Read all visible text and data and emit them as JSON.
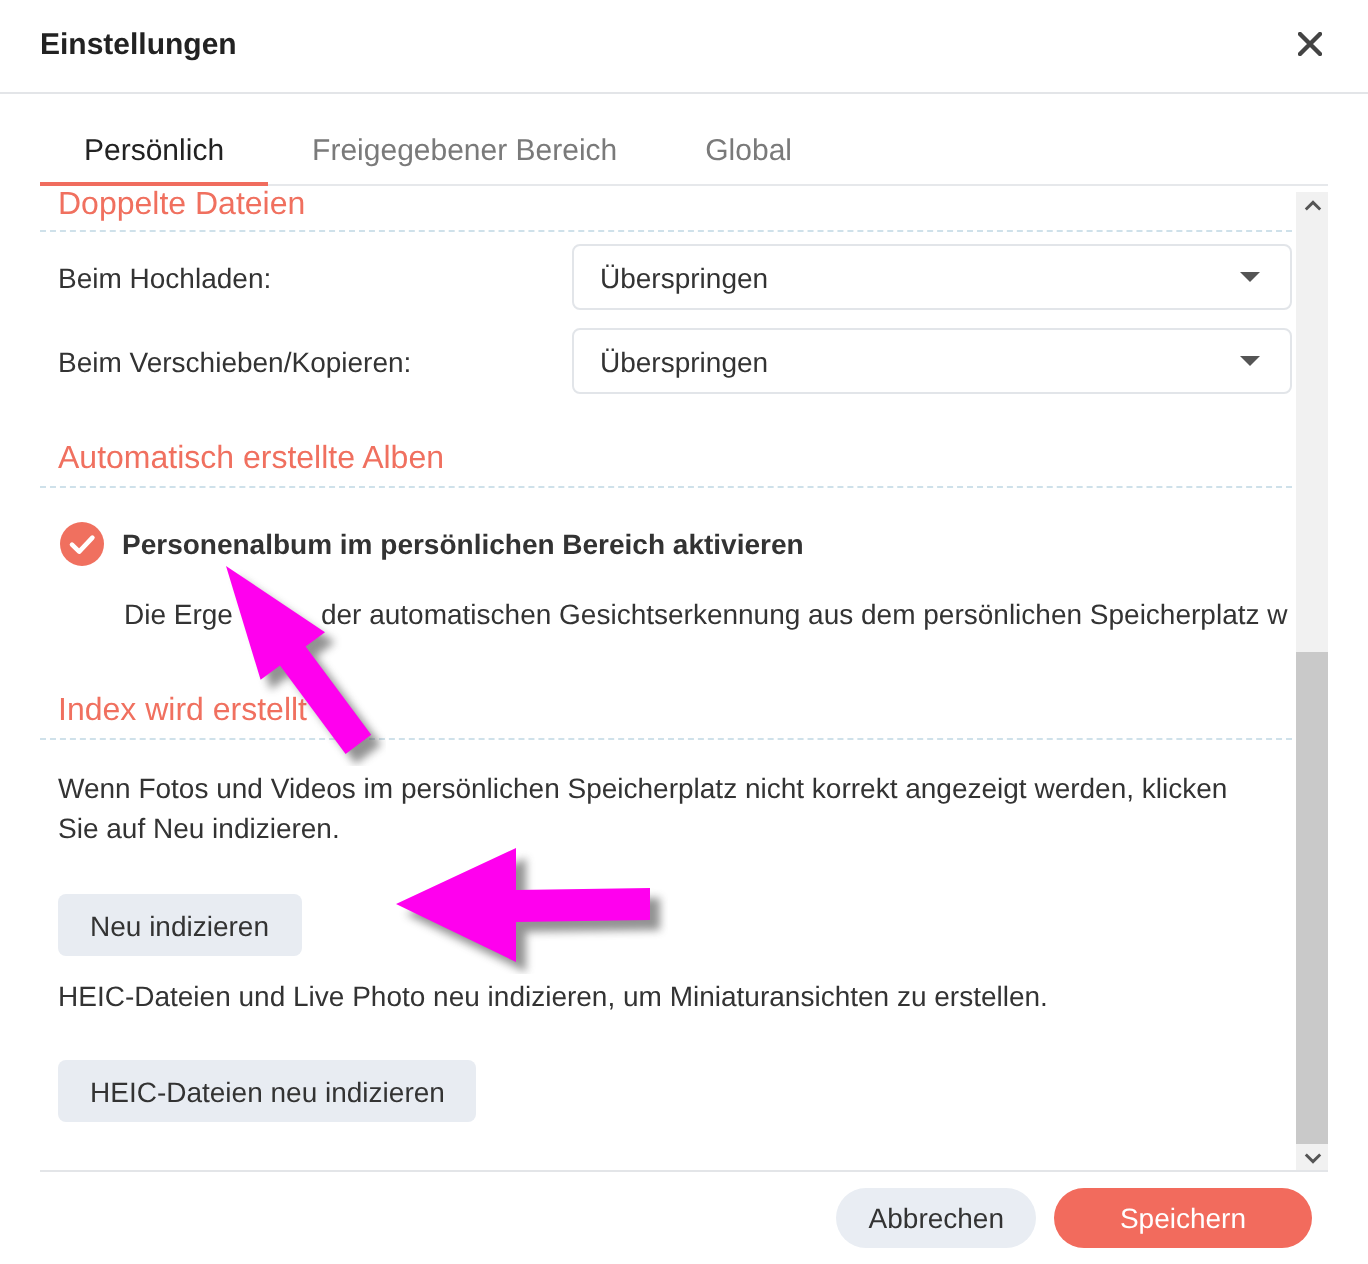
{
  "window": {
    "title": "Einstellungen"
  },
  "tabs": [
    {
      "label": "Persönlich",
      "selected": true
    },
    {
      "label": "Freigegebener Bereich",
      "selected": false
    },
    {
      "label": "Global",
      "selected": false
    }
  ],
  "sections": [
    {
      "heading": "Doppelte Dateien",
      "items": [
        {
          "kind": "select",
          "label": "Beim Hochladen:",
          "value": "Überspringen"
        },
        {
          "kind": "select",
          "label": "Beim Verschieben/Kopieren:",
          "value": "Überspringen"
        }
      ]
    },
    {
      "heading": "Automatisch erstellte Alben",
      "items": [
        {
          "kind": "checkbox",
          "label": "Personenalbum im persönlichen Bereich aktivieren",
          "checked": true,
          "description_parts": [
            "Die Erge",
            "der automatischen Gesichtserkennung aus dem persönlichen Speicherplatz w"
          ]
        }
      ]
    },
    {
      "heading": "Index wird erstellt",
      "items": [
        {
          "kind": "text",
          "text": "Wenn Fotos und Videos im persönlichen Speicherplatz nicht korrekt angezeigt werden, klicken Sie auf Neu indizieren."
        },
        {
          "kind": "button",
          "label": "Neu indizieren"
        },
        {
          "kind": "text",
          "text": "HEIC-Dateien und Live Photo neu indizieren, um Miniaturansichten zu erstellen."
        },
        {
          "kind": "button",
          "label": "HEIC-Dateien neu indizieren"
        }
      ]
    }
  ],
  "footer": {
    "buttons": [
      {
        "kind": "secondary",
        "label": "Abbrechen"
      },
      {
        "kind": "primary",
        "label": "Speichern"
      }
    ]
  },
  "annotations": [
    {
      "kind": "arrow"
    },
    {
      "kind": "arrow"
    }
  ]
}
